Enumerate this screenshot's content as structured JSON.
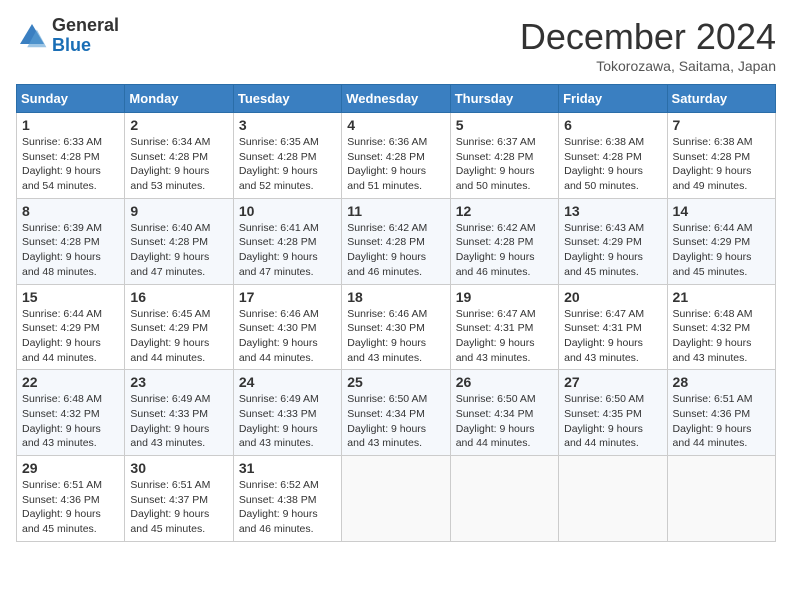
{
  "logo": {
    "general": "General",
    "blue": "Blue"
  },
  "title": "December 2024",
  "location": "Tokorozawa, Saitama, Japan",
  "days_of_week": [
    "Sunday",
    "Monday",
    "Tuesday",
    "Wednesday",
    "Thursday",
    "Friday",
    "Saturday"
  ],
  "weeks": [
    [
      {
        "day": "1",
        "sunrise": "6:33 AM",
        "sunset": "4:28 PM",
        "daylight": "9 hours and 54 minutes."
      },
      {
        "day": "2",
        "sunrise": "6:34 AM",
        "sunset": "4:28 PM",
        "daylight": "9 hours and 53 minutes."
      },
      {
        "day": "3",
        "sunrise": "6:35 AM",
        "sunset": "4:28 PM",
        "daylight": "9 hours and 52 minutes."
      },
      {
        "day": "4",
        "sunrise": "6:36 AM",
        "sunset": "4:28 PM",
        "daylight": "9 hours and 51 minutes."
      },
      {
        "day": "5",
        "sunrise": "6:37 AM",
        "sunset": "4:28 PM",
        "daylight": "9 hours and 50 minutes."
      },
      {
        "day": "6",
        "sunrise": "6:38 AM",
        "sunset": "4:28 PM",
        "daylight": "9 hours and 50 minutes."
      },
      {
        "day": "7",
        "sunrise": "6:38 AM",
        "sunset": "4:28 PM",
        "daylight": "9 hours and 49 minutes."
      }
    ],
    [
      {
        "day": "8",
        "sunrise": "6:39 AM",
        "sunset": "4:28 PM",
        "daylight": "9 hours and 48 minutes."
      },
      {
        "day": "9",
        "sunrise": "6:40 AM",
        "sunset": "4:28 PM",
        "daylight": "9 hours and 47 minutes."
      },
      {
        "day": "10",
        "sunrise": "6:41 AM",
        "sunset": "4:28 PM",
        "daylight": "9 hours and 47 minutes."
      },
      {
        "day": "11",
        "sunrise": "6:42 AM",
        "sunset": "4:28 PM",
        "daylight": "9 hours and 46 minutes."
      },
      {
        "day": "12",
        "sunrise": "6:42 AM",
        "sunset": "4:28 PM",
        "daylight": "9 hours and 46 minutes."
      },
      {
        "day": "13",
        "sunrise": "6:43 AM",
        "sunset": "4:29 PM",
        "daylight": "9 hours and 45 minutes."
      },
      {
        "day": "14",
        "sunrise": "6:44 AM",
        "sunset": "4:29 PM",
        "daylight": "9 hours and 45 minutes."
      }
    ],
    [
      {
        "day": "15",
        "sunrise": "6:44 AM",
        "sunset": "4:29 PM",
        "daylight": "9 hours and 44 minutes."
      },
      {
        "day": "16",
        "sunrise": "6:45 AM",
        "sunset": "4:29 PM",
        "daylight": "9 hours and 44 minutes."
      },
      {
        "day": "17",
        "sunrise": "6:46 AM",
        "sunset": "4:30 PM",
        "daylight": "9 hours and 44 minutes."
      },
      {
        "day": "18",
        "sunrise": "6:46 AM",
        "sunset": "4:30 PM",
        "daylight": "9 hours and 43 minutes."
      },
      {
        "day": "19",
        "sunrise": "6:47 AM",
        "sunset": "4:31 PM",
        "daylight": "9 hours and 43 minutes."
      },
      {
        "day": "20",
        "sunrise": "6:47 AM",
        "sunset": "4:31 PM",
        "daylight": "9 hours and 43 minutes."
      },
      {
        "day": "21",
        "sunrise": "6:48 AM",
        "sunset": "4:32 PM",
        "daylight": "9 hours and 43 minutes."
      }
    ],
    [
      {
        "day": "22",
        "sunrise": "6:48 AM",
        "sunset": "4:32 PM",
        "daylight": "9 hours and 43 minutes."
      },
      {
        "day": "23",
        "sunrise": "6:49 AM",
        "sunset": "4:33 PM",
        "daylight": "9 hours and 43 minutes."
      },
      {
        "day": "24",
        "sunrise": "6:49 AM",
        "sunset": "4:33 PM",
        "daylight": "9 hours and 43 minutes."
      },
      {
        "day": "25",
        "sunrise": "6:50 AM",
        "sunset": "4:34 PM",
        "daylight": "9 hours and 43 minutes."
      },
      {
        "day": "26",
        "sunrise": "6:50 AM",
        "sunset": "4:34 PM",
        "daylight": "9 hours and 44 minutes."
      },
      {
        "day": "27",
        "sunrise": "6:50 AM",
        "sunset": "4:35 PM",
        "daylight": "9 hours and 44 minutes."
      },
      {
        "day": "28",
        "sunrise": "6:51 AM",
        "sunset": "4:36 PM",
        "daylight": "9 hours and 44 minutes."
      }
    ],
    [
      {
        "day": "29",
        "sunrise": "6:51 AM",
        "sunset": "4:36 PM",
        "daylight": "9 hours and 45 minutes."
      },
      {
        "day": "30",
        "sunrise": "6:51 AM",
        "sunset": "4:37 PM",
        "daylight": "9 hours and 45 minutes."
      },
      {
        "day": "31",
        "sunrise": "6:52 AM",
        "sunset": "4:38 PM",
        "daylight": "9 hours and 46 minutes."
      },
      null,
      null,
      null,
      null
    ]
  ]
}
